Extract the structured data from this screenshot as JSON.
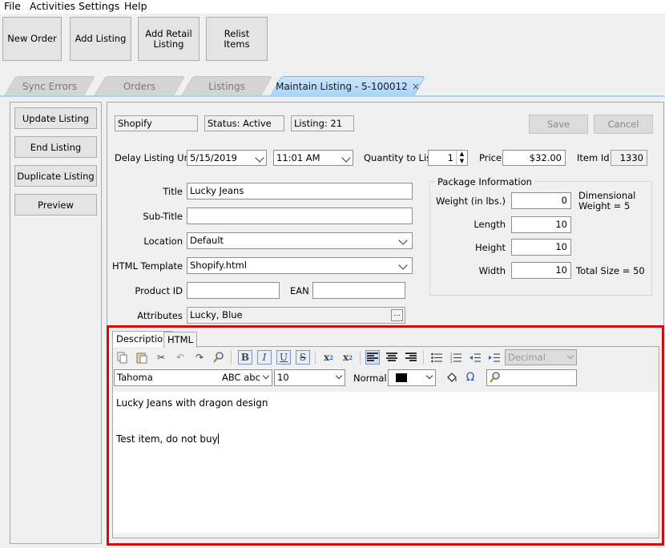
{
  "menu": [
    "File",
    "Activities",
    "Settings",
    "Help"
  ],
  "toolbar": {
    "new_order": "New Order",
    "add_listing": "Add Listing",
    "add_retail_listing": "Add Retail Listing",
    "relist_items": "Relist Items"
  },
  "tabs": [
    {
      "label": "Sync Errors",
      "active": false
    },
    {
      "label": "Orders",
      "active": false
    },
    {
      "label": "Listings",
      "active": false
    },
    {
      "label": "Maintain Listing - 5-100012",
      "active": true,
      "close": "×"
    }
  ],
  "side_actions": {
    "update": "Update Listing",
    "end": "End Listing",
    "duplicate": "Duplicate Listing",
    "preview": "Preview"
  },
  "header": {
    "channel": "Shopify",
    "status": "Status: Active",
    "listing": "Listing: 21",
    "save": "Save",
    "cancel": "Cancel"
  },
  "form": {
    "delay_label": "Delay Listing Until",
    "delay_date": "5/15/2019",
    "delay_time": "11:01 AM",
    "qty_label": "Quantity to List",
    "qty_value": "1",
    "price_label": "Price",
    "price_value": "$32.00",
    "item_id_label": "Item Id",
    "item_id_value": "1330",
    "title_label": "Title",
    "title_value": "Lucky Jeans",
    "subtitle_label": "Sub-Title",
    "subtitle_value": "",
    "location_label": "Location",
    "location_value": "Default",
    "html_template_label": "HTML Template",
    "html_template_value": "Shopify.html",
    "product_id_label": "Product ID",
    "product_id_value": "",
    "ean_label": "EAN",
    "ean_value": "",
    "attributes_label": "Attributes",
    "attributes_value": "Lucky, Blue",
    "attributes_button": "..."
  },
  "package": {
    "legend": "Package Information",
    "weight_label": "Weight (in lbs.)",
    "weight_value": "0",
    "dimensional_label": "Dimensional",
    "dimensional_weight": "Weight = 5",
    "length_label": "Length",
    "length_value": "10",
    "height_label": "Height",
    "height_value": "10",
    "width_label": "Width",
    "width_value": "10",
    "total_size": "Total Size = 50"
  },
  "editor": {
    "tab_description": "Description",
    "tab_html": "HTML",
    "font_family": "Tahoma",
    "font_preview": "ABC abc",
    "font_size": "10",
    "style_label": "Normal",
    "list_style": "Decimal",
    "text_color": "#000000",
    "highlight_color": "#d00d0d",
    "line1": "Lucky Jeans with dragon design",
    "line2": "Test item, do not buy",
    "icons": [
      "copy-icon",
      "paste-icon",
      "cut-icon",
      "undo-icon",
      "redo-icon",
      "find-icon",
      "bold-icon",
      "italic-icon",
      "underline-icon",
      "strikethrough-icon",
      "subscript-icon",
      "superscript-icon",
      "align-left-icon",
      "align-center-icon",
      "align-right-icon",
      "bullet-list-icon",
      "numbered-list-icon",
      "outdent-icon",
      "indent-icon",
      "paint-bucket-icon",
      "omega-icon",
      "search-icon"
    ]
  }
}
